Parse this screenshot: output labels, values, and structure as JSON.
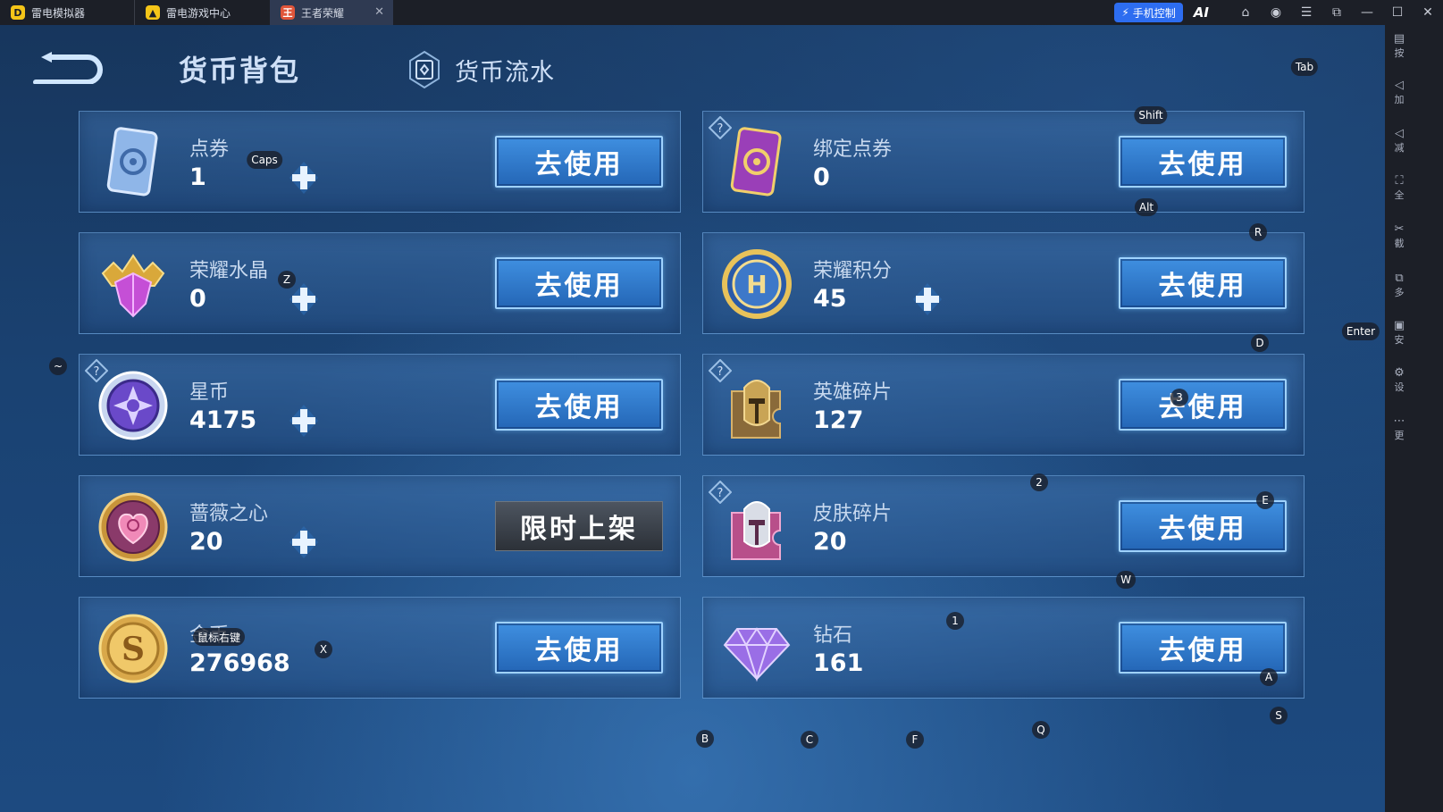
{
  "titlebar": {
    "tabs": [
      {
        "label": "雷电模拟器",
        "icon": "leidian-logo-icon",
        "color": "#f5c518"
      },
      {
        "label": "雷电游戏中心",
        "icon": "game-center-icon",
        "color": "#f5c518"
      },
      {
        "label": "王者荣耀",
        "icon": "honor-of-kings-icon",
        "color": "#e0553a",
        "close": "✕"
      }
    ],
    "phone_control": "手机控制",
    "ai_label": "AI",
    "buttons": [
      {
        "name": "store-icon",
        "glyph": "⌂"
      },
      {
        "name": "avatar-icon",
        "glyph": "◉"
      },
      {
        "name": "menu-icon",
        "glyph": "☰"
      },
      {
        "name": "shrink-icon",
        "glyph": "⧉"
      },
      {
        "name": "minimize-icon",
        "glyph": "—"
      },
      {
        "name": "maximize-icon",
        "glyph": "☐"
      },
      {
        "name": "close-icon",
        "glyph": "✕"
      }
    ]
  },
  "header": {
    "title": "货币背包",
    "flow_label": "货币流水"
  },
  "currencies": [
    {
      "name": "点券",
      "amount": "1",
      "action": "去使用",
      "icon": "voucher-card-icon",
      "plus": true,
      "help": false
    },
    {
      "name": "绑定点券",
      "amount": "0",
      "action": "去使用",
      "icon": "bound-voucher-card-icon",
      "plus": false,
      "help": true
    },
    {
      "name": "荣耀水晶",
      "amount": "0",
      "action": "去使用",
      "icon": "glory-crystal-icon",
      "plus": true,
      "help": false
    },
    {
      "name": "荣耀积分",
      "amount": "45",
      "action": "去使用",
      "icon": "glory-points-icon",
      "plus": true,
      "help": false
    },
    {
      "name": "星币",
      "amount": "4175",
      "action": "去使用",
      "icon": "star-coin-icon",
      "plus": true,
      "help": true
    },
    {
      "name": "英雄碎片",
      "amount": "127",
      "action": "去使用",
      "icon": "hero-fragment-icon",
      "plus": false,
      "help": true
    },
    {
      "name": "蔷薇之心",
      "amount": "20",
      "action": "限时上架",
      "icon": "rose-heart-icon",
      "plus": true,
      "help": false
    },
    {
      "name": "皮肤碎片",
      "amount": "20",
      "action": "去使用",
      "icon": "skin-fragment-icon",
      "plus": false,
      "help": true
    },
    {
      "name": "金币",
      "amount": "276968",
      "action": "去使用",
      "icon": "gold-coin-icon",
      "plus": false,
      "help": false
    },
    {
      "name": "钻石",
      "amount": "161",
      "action": "去使用",
      "icon": "diamond-icon",
      "plus": false,
      "help": false
    }
  ],
  "key_overlay": [
    "Tab",
    "Shift",
    "Caps",
    "Alt",
    "R",
    "Z",
    "D",
    "Enter",
    "~",
    "3",
    "2",
    "E",
    "W",
    "1",
    "鼠标右键",
    "X",
    "A",
    "S",
    "B",
    "C",
    "F",
    "Q"
  ],
  "sidebar": {
    "items": [
      {
        "glyph": "▤",
        "label": "按"
      },
      {
        "glyph": "◁",
        "label": "加"
      },
      {
        "glyph": "◁",
        "label": "减"
      },
      {
        "glyph": "⛶",
        "label": "全"
      },
      {
        "glyph": "✂",
        "label": "截"
      },
      {
        "glyph": "⧉",
        "label": "多"
      },
      {
        "glyph": "▣",
        "label": "安"
      },
      {
        "glyph": "⚙",
        "label": "设"
      },
      {
        "glyph": "⋯",
        "label": "更"
      }
    ]
  }
}
